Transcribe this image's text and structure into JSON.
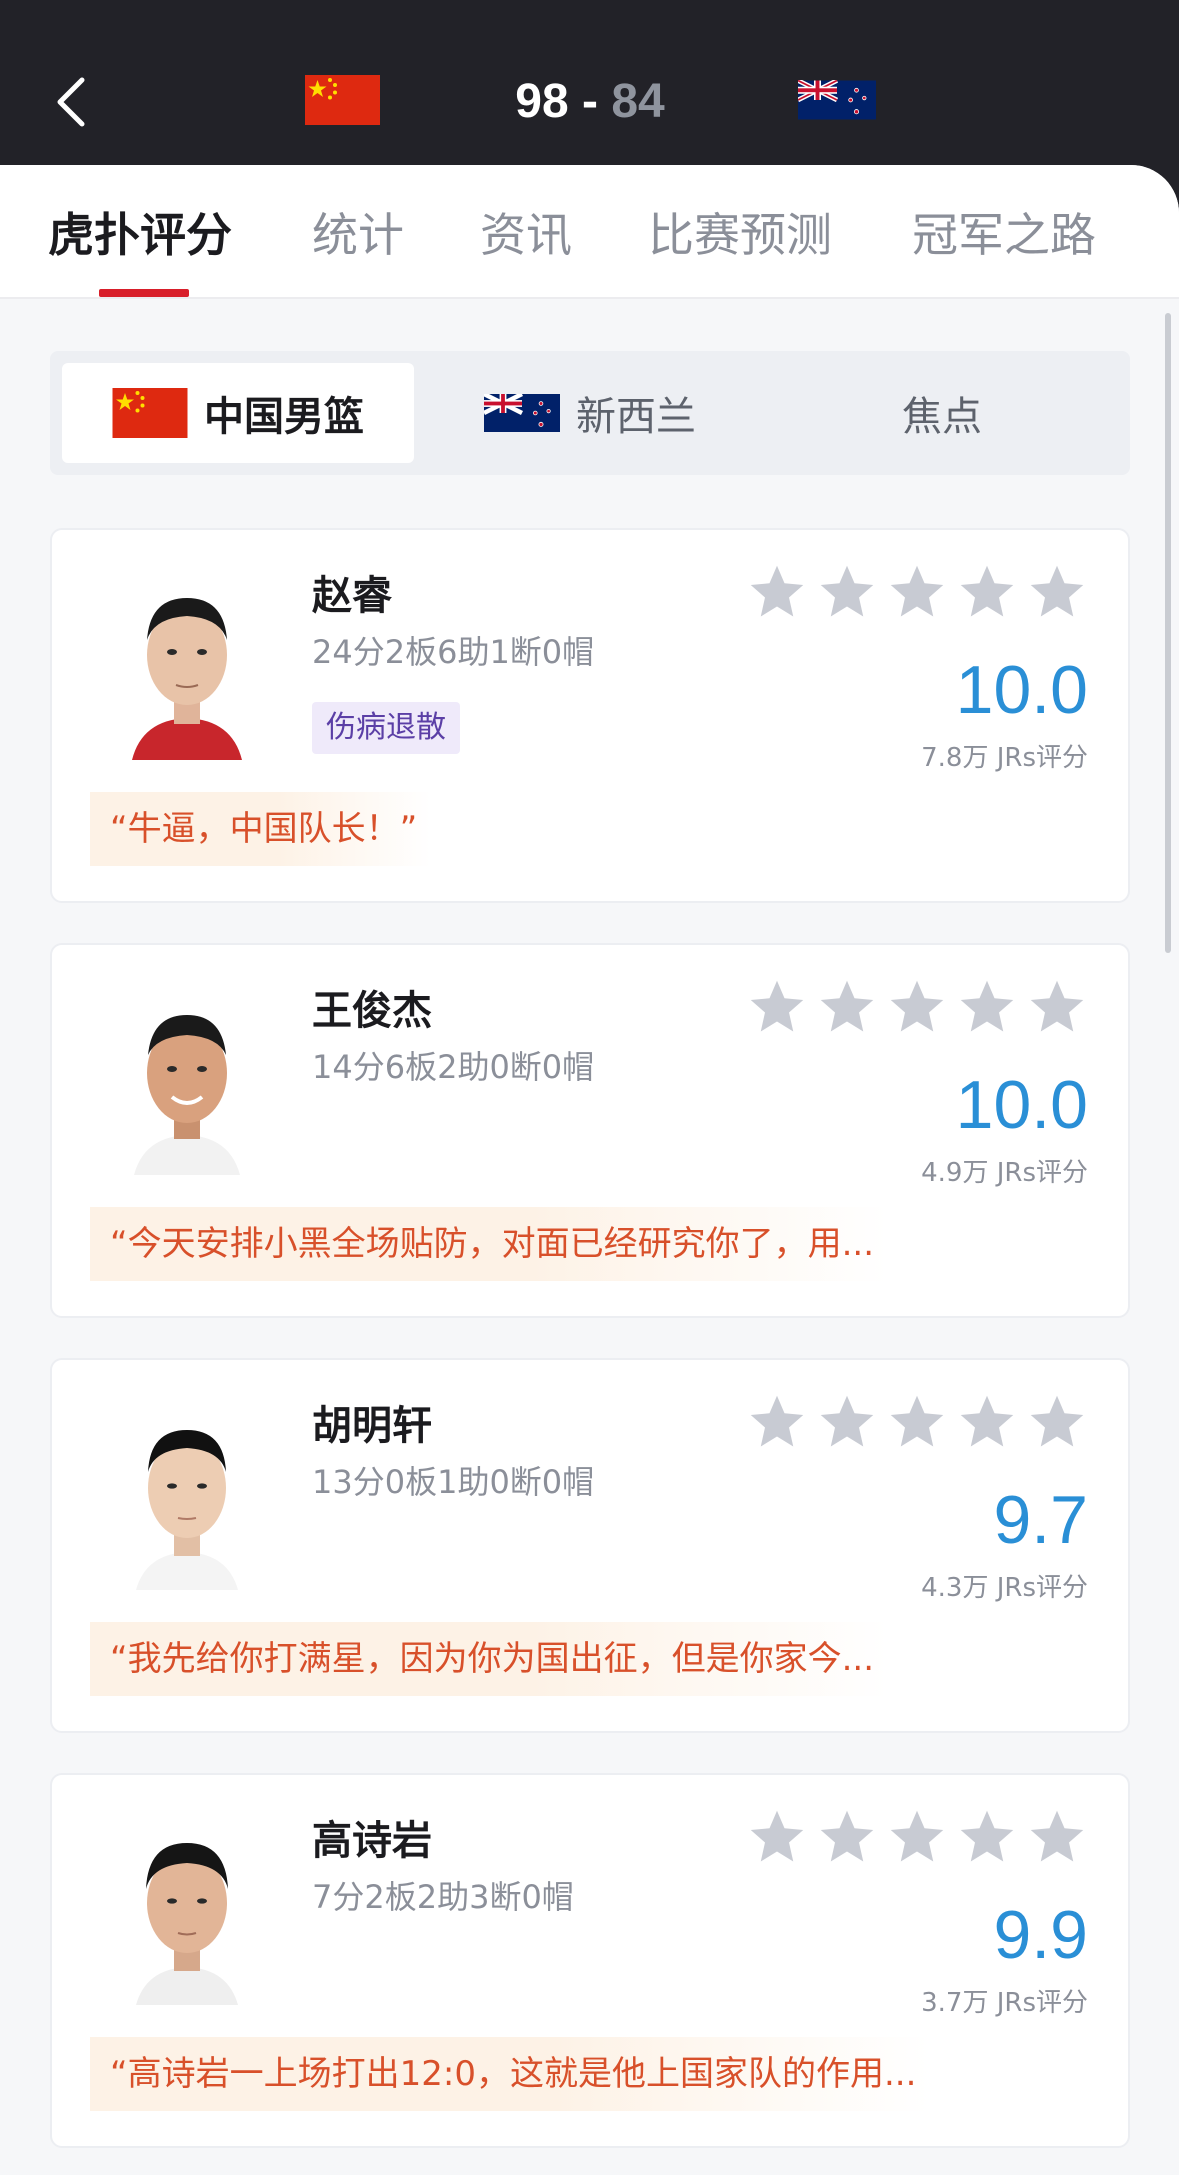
{
  "header": {
    "home_score": "98",
    "separator": "-",
    "away_score": "84",
    "back_icon": "chevron-left-icon",
    "home_flag": "china-flag",
    "away_flag": "new-zealand-flag"
  },
  "tabs": [
    "虎扑评分",
    "统计",
    "资讯",
    "比赛预测",
    "冠军之路"
  ],
  "active_tab": 0,
  "team_switch": {
    "items": [
      "中国男篮",
      "新西兰",
      "焦点"
    ],
    "active": 0
  },
  "players": [
    {
      "name": "赵睿",
      "stats": "24分2板6助1断0帽",
      "tag": "伤病退散",
      "rating": "10.0",
      "votes": "7.8万 JRs评分",
      "comment": "“牛逼，中国队长！”",
      "stars_filled": 0
    },
    {
      "name": "王俊杰",
      "stats": "14分6板2助0断0帽",
      "tag": "",
      "rating": "10.0",
      "votes": "4.9万 JRs评分",
      "comment": "“今天安排小黑全场贴防，对面已经研究你了，用...",
      "stars_filled": 0
    },
    {
      "name": "胡明轩",
      "stats": "13分0板1助0断0帽",
      "tag": "",
      "rating": "9.7",
      "votes": "4.3万 JRs评分",
      "comment": "“我先给你打满星，因为你为国出征，但是你家今...",
      "stars_filled": 0
    },
    {
      "name": "高诗岩",
      "stats": "7分2板2助3断0帽",
      "tag": "",
      "rating": "9.9",
      "votes": "3.7万 JRs评分",
      "comment": "“高诗岩一上场打出12:0，这就是他上国家队的作用...",
      "stars_filled": 0
    }
  ],
  "colors": {
    "header_bg": "#222228",
    "accent_red": "#d81e2a",
    "rating_blue": "#2a8fd6",
    "comment_orange": "#d8502a",
    "star_gray": "#c8cbd3"
  }
}
